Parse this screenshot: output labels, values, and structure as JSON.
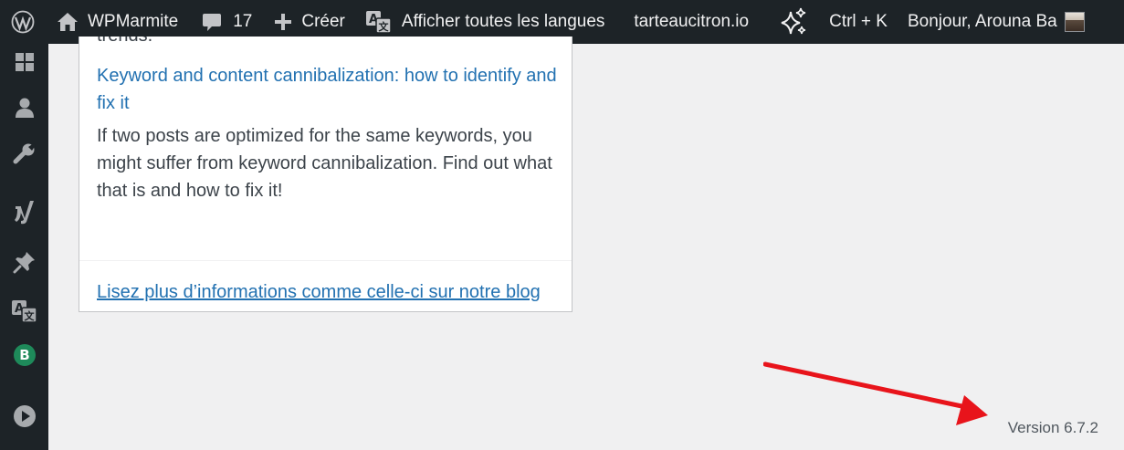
{
  "adminbar": {
    "site_name": "WPMarmite",
    "comments_count": "17",
    "new_label": "Créer",
    "languages_label": "Afficher toutes les langues",
    "tarteaucitron_label": "tarteaucitron.io",
    "shortcut_label": "Ctrl + K",
    "greeting": "Bonjour, Arouna Ba"
  },
  "sidebar": {
    "icons": [
      "dashboard-icon",
      "users-icon",
      "tools-icon",
      "yoast-icon",
      "pin-icon",
      "translate-icon",
      "b-plugin-icon",
      "play-icon"
    ],
    "b_letter": "B"
  },
  "widget": {
    "clipped_text": "trends.",
    "post_title": "Keyword and content cannibalization: how to identify and fix it",
    "post_excerpt": "If two posts are optimized for the same keywords, you might suffer from keyword cannibalization. Find out what that is and how to fix it!",
    "read_more_link": "Lisez plus d’informations comme celle-ci sur notre blog SEO"
  },
  "footer": {
    "version": "Version 6.7.2"
  },
  "colors": {
    "adminbar_bg": "#1d2327",
    "link": "#2271b1",
    "arrow": "#e8141b"
  }
}
